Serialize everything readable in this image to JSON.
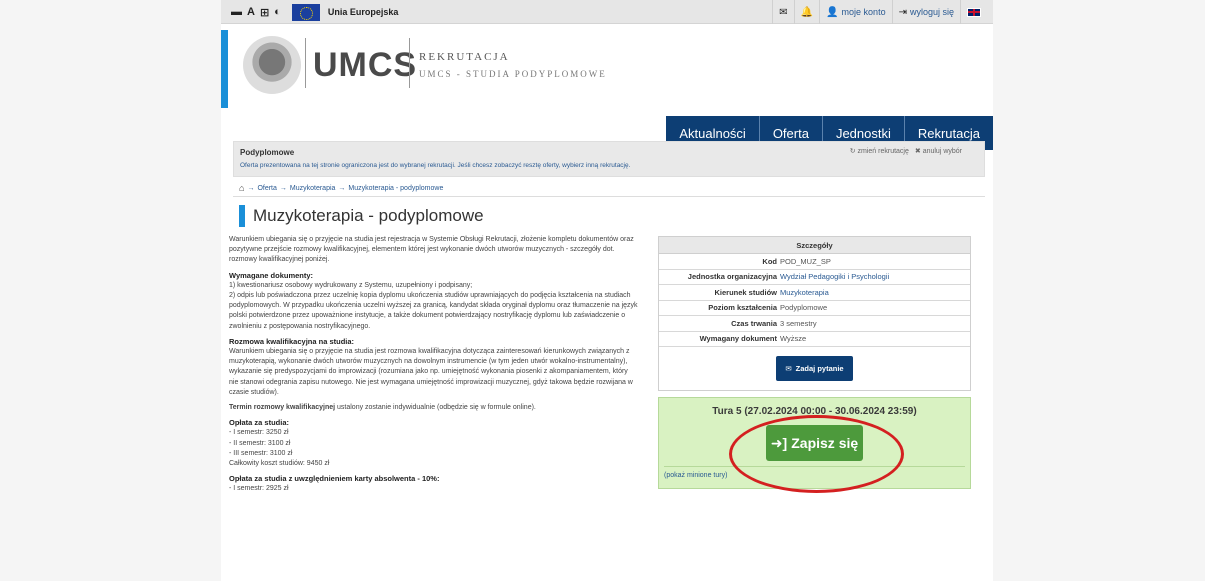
{
  "topbar": {
    "font_icon": "A",
    "eu_label": "Unia Europejska",
    "account_label": "moje konto",
    "logout_label": "wyloguj się"
  },
  "header": {
    "logo_text": "UMCS",
    "title": "REKRUTACJA",
    "subtitle": "UMCS - STUDIA PODYPLOMOWE"
  },
  "nav": {
    "items": [
      {
        "label": "Aktualności"
      },
      {
        "label": "Oferta"
      },
      {
        "label": "Jednostki"
      },
      {
        "label": "Rekrutacja"
      }
    ]
  },
  "recruitment": {
    "title": "Podyplomowe",
    "description": "Oferta prezentowana na tej stronie ograniczona jest do wybranej rekrutacji. Jeśli chcesz zobaczyć resztę oferty, wybierz inną rekrutację.",
    "change_label": "zmień rekrutację",
    "cancel_label": "anuluj wybór"
  },
  "breadcrumb": {
    "items": [
      "Oferta",
      "Muzykoterapia",
      "Muzykoterapia - podyplomowe"
    ]
  },
  "page": {
    "title": "Muzykoterapia - podyplomowe"
  },
  "content": {
    "intro": "Warunkiem ubiegania się o przyjęcie na studia jest rejestracja w Systemie Obsługi Rekrutacji, złożenie kompletu dokumentów oraz pozytywne przejście rozmowy kwalifikacyjnej, elementem której jest wykonanie dwóch utworów muzycznych - szczegóły dot. rozmowy kwalifikacyjnej poniżej.",
    "docs_heading": "Wymagane dokumenty:",
    "docs_1": "1) kwestionariusz osobowy wydrukowany z Systemu, uzupełniony i podpisany;",
    "docs_2": "2) odpis lub poświadczona przez uczelnię kopia dyplomu ukończenia studiów uprawniających do podjęcia kształcenia na studiach podyplomowych. W przypadku ukończenia uczelni wyższej za granicą, kandydat składa oryginał dyplomu oraz tłumaczenie na język polski potwierdzone przez upoważnione instytucje, a także dokument potwierdzający nostryfikację dyplomu lub zaświadczenie o zwolnieniu z postępowania nostryfikacyjnego.",
    "interview_heading": "Rozmowa kwalifikacyjna na studia:",
    "interview_text": "Warunkiem ubiegania się o przyjęcie na studia jest rozmowa kwalifikacyjna dotycząca zainteresowań kierunkowych związanych z muzykoterapią, wykonanie dwóch utworów muzycznych na dowolnym instrumencie (w tym jeden utwór wokalno-instrumentalny), wykazanie się predyspozycjami do improwizacji (rozumiana jako np. umiejętność wykonania piosenki z akompaniamentem, który nie stanowi odegrania zapisu nutowego. Nie jest wymagana umiejętność improwizacji muzycznej, gdyż takowa będzie rozwijana w czasie studiów).",
    "term_bold": "Termin rozmowy kwalifikacyjnej",
    "term_rest": " ustalony zostanie indywidualnie (odbędzie się w formule online).",
    "fees_heading": "Opłata za studia:",
    "fees": [
      "- I semestr: 3250 zł",
      "- II semestr: 3100 zł",
      "- III semestr: 3100 zł",
      "Całkowity koszt studiów: 9450 zł"
    ],
    "fees2_heading": "Opłata za studia z uwzględnieniem karty absolwenta - 10%:",
    "fees2": [
      "- I semestr: 2925 zł"
    ]
  },
  "details": {
    "heading": "Szczegóły",
    "rows": [
      {
        "key": "Kod",
        "value": "POD_MUZ_SP"
      },
      {
        "key": "Jednostka organizacyjna",
        "value": "Wydział Pedagogiki i Psychologii"
      },
      {
        "key": "Kierunek studiów",
        "value": "Muzykoterapia"
      },
      {
        "key": "Poziom kształcenia",
        "value": "Podyplomowe"
      },
      {
        "key": "Czas trwania",
        "value": "3 semestry"
      },
      {
        "key": "Wymagany dokument",
        "value": "Wyższe"
      }
    ],
    "ask_button": "Zadaj pytanie"
  },
  "tura": {
    "title": "Tura 5 (27.02.2024 00:00 - 30.06.2024 23:59)",
    "join_button": "Zapisz się",
    "past_link": "(pokaż minione tury)"
  },
  "colors": {
    "nav": "#0d3e74",
    "accent": "#1a8fd8",
    "join": "#4d9a3c",
    "tura_bg": "#d9f2c2",
    "annotation": "#d42020"
  },
  "icons": [
    "text-size-icon",
    "contrast-icon",
    "envelope-icon",
    "bell-icon",
    "user-icon",
    "logout-icon",
    "uk-flag-icon",
    "refresh-icon",
    "x-icon",
    "home-icon",
    "signin-icon"
  ]
}
